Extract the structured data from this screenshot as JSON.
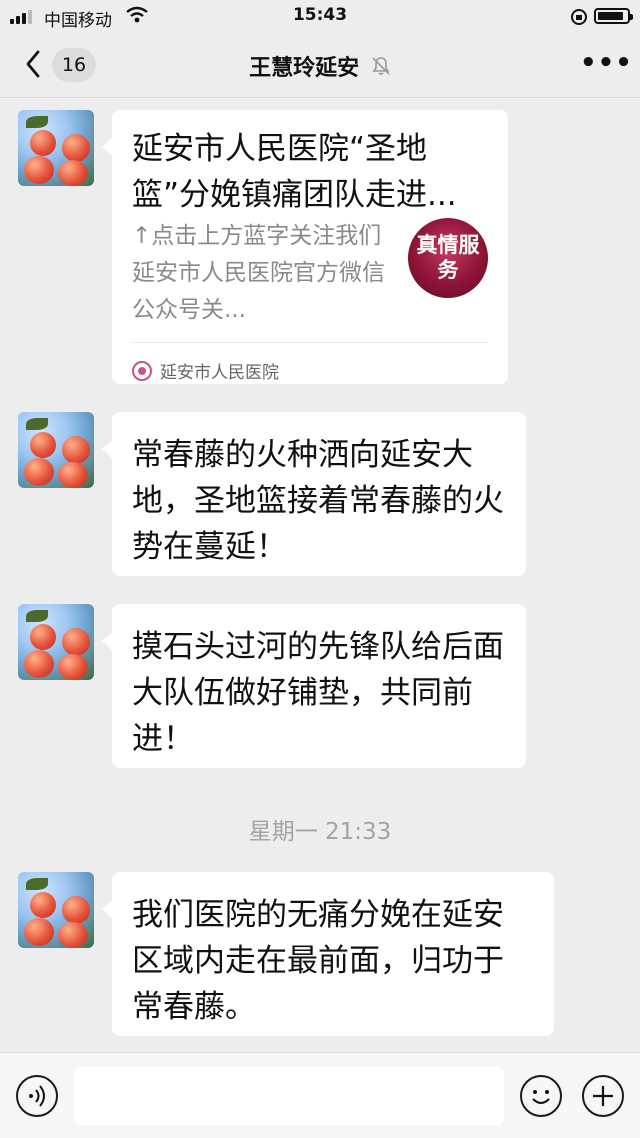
{
  "status_bar": {
    "carrier": "中国移动",
    "time": "15:43",
    "battery_level": 0.9
  },
  "navbar": {
    "unread_count": "16",
    "title": "王慧玲延安",
    "icons": [
      "back-chevron-icon",
      "mute-bell-icon",
      "more-dots-icon"
    ]
  },
  "messages": [
    {
      "type": "article-card",
      "title": "延安市人民医院“圣地篮”分娩镇痛团队走进...",
      "description": "↑点击上方蓝字关注我们延安市人民医院官方微信公众号关...",
      "thumb_text": "真情服务",
      "source": "延安市人民医院"
    },
    {
      "type": "text",
      "text": "常春藤的火种洒向延安大地，圣地篮接着常春藤的火势在蔓延！"
    },
    {
      "type": "text",
      "text": "摸石头过河的先锋队给后面大队伍做好铺垫，共同前进！"
    },
    {
      "type": "timestamp",
      "text": "星期一 21:33"
    },
    {
      "type": "text",
      "text": "我们医院的无痛分娩在延安区域内走在最前面，归功于常春藤。"
    }
  ],
  "input_bar": {
    "placeholder": "",
    "icons": [
      "voice-icon",
      "emoji-icon",
      "plus-icon"
    ]
  }
}
